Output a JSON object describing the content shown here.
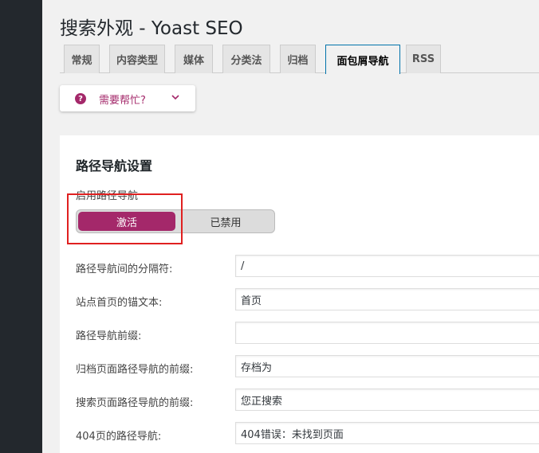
{
  "page": {
    "title": "搜索外观 - Yoast SEO"
  },
  "tabs": [
    {
      "label": "常规"
    },
    {
      "label": "内容类型"
    },
    {
      "label": "媒体"
    },
    {
      "label": "分类法"
    },
    {
      "label": "归档"
    },
    {
      "label": "面包屑导航",
      "active": true
    },
    {
      "label": "RSS"
    }
  ],
  "help": {
    "icon_glyph": "?",
    "label": "需要帮忙?",
    "icon": "chevron-down-icon"
  },
  "breadcrumbs": {
    "section_title": "路径导航设置",
    "enable_label": "启用路径导航",
    "toggle": {
      "on_label": "激活",
      "off_label": "已禁用",
      "selected": "on"
    },
    "fields": [
      {
        "label": "路径导航间的分隔符:",
        "value": "/"
      },
      {
        "label": "站点首页的锚文本:",
        "value": "首页"
      },
      {
        "label": "路径导航前缀:",
        "value": ""
      },
      {
        "label": "归档页面路径导航的前缀:",
        "value": "存档为"
      },
      {
        "label": "搜索页面路径导航的前缀:",
        "value": "您正搜索"
      },
      {
        "label": "404页的路径导航:",
        "value": "404错误：未找到页面"
      }
    ]
  },
  "colors": {
    "accent": "#a4286a",
    "admin_bar": "#23282d",
    "active_tab_border": "#0073aa",
    "annotation": "#e02020"
  }
}
